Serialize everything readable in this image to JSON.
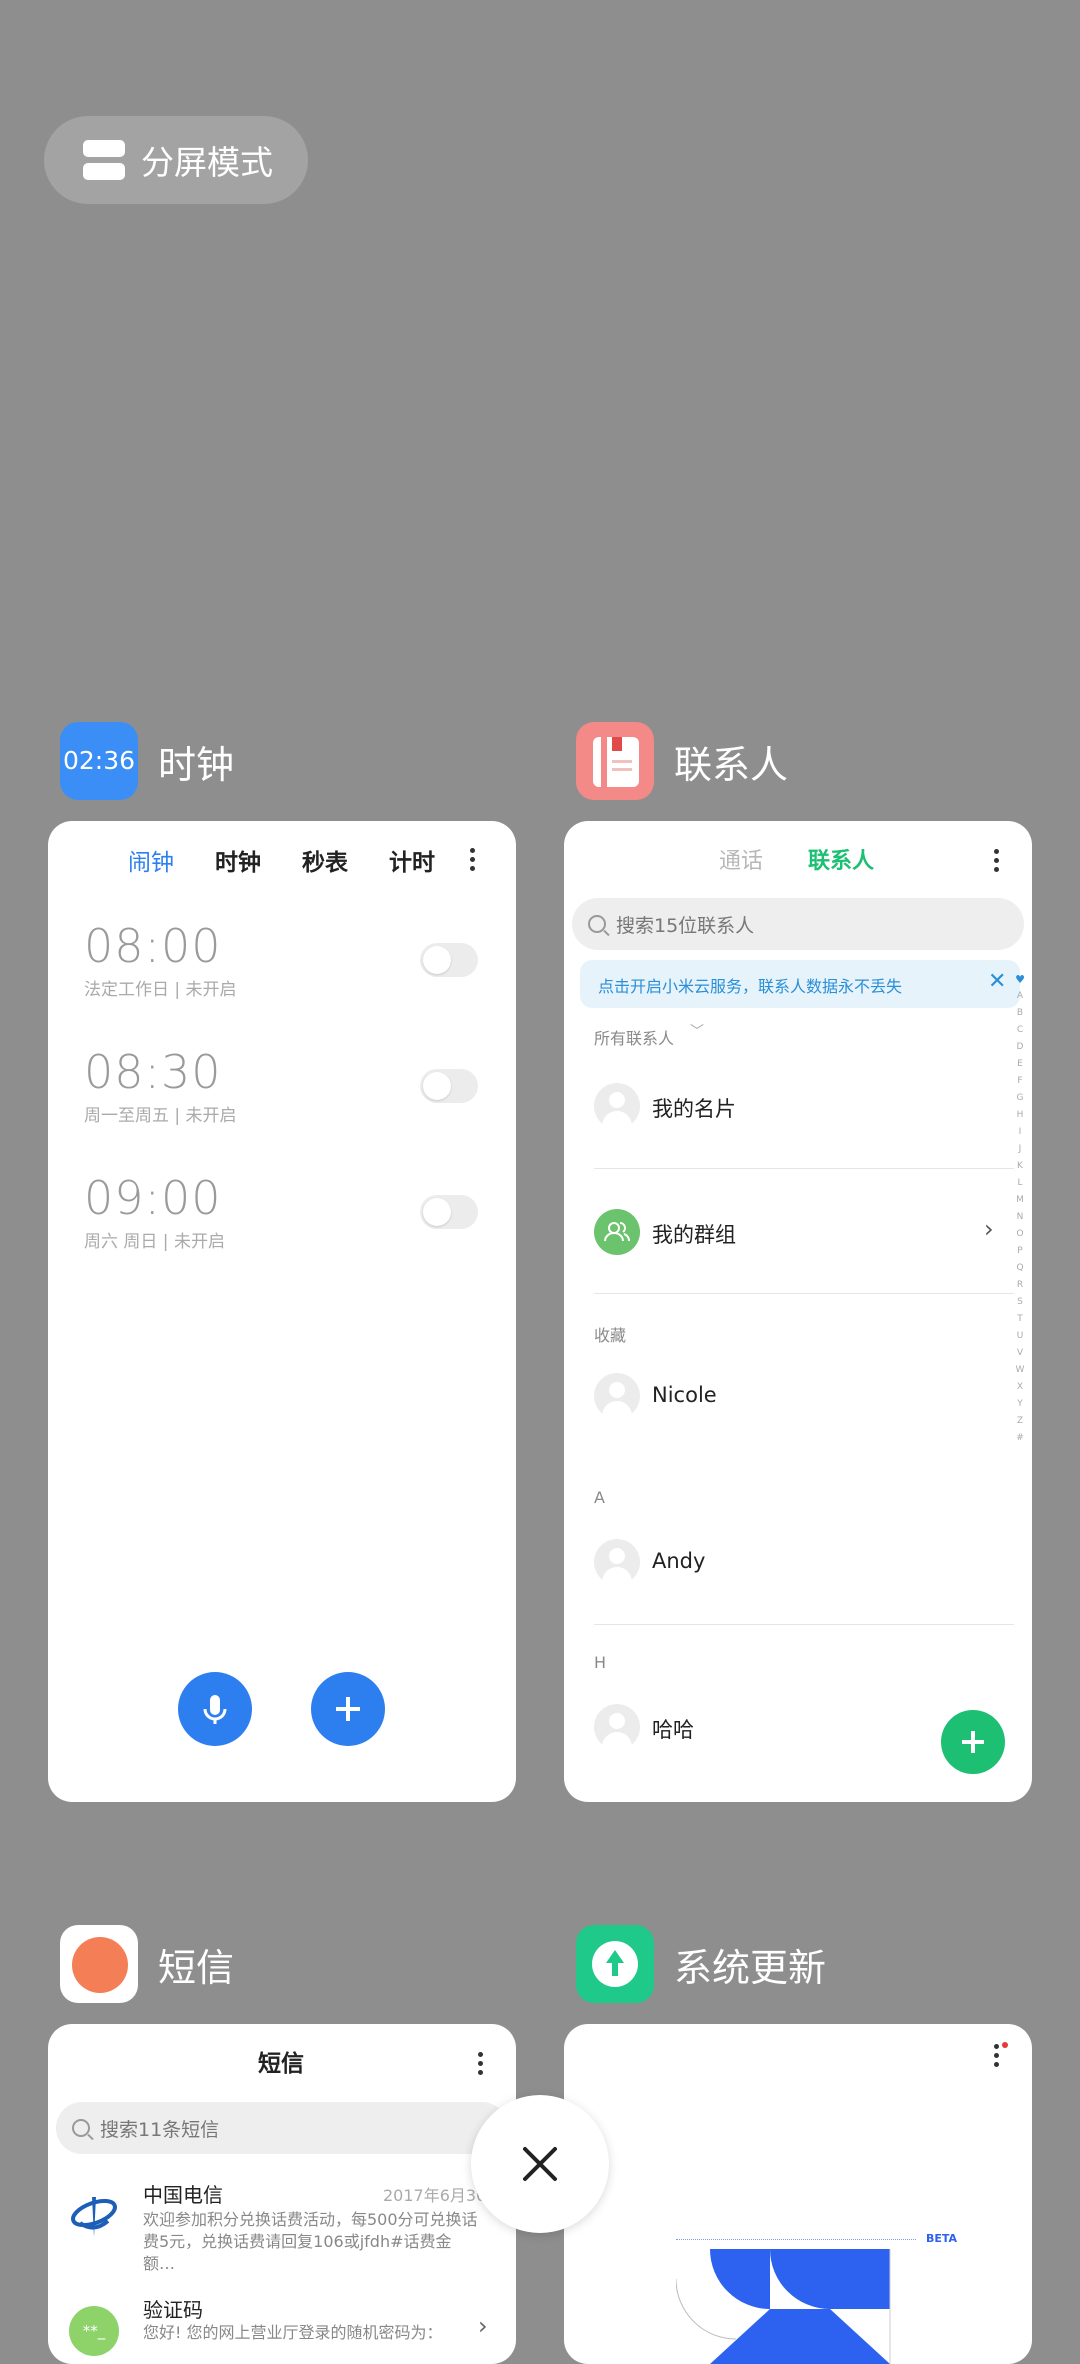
{
  "split": {
    "label": "分屏模式"
  },
  "apps": {
    "clock": {
      "name": "时钟",
      "icon_time": "02:36"
    },
    "contacts": {
      "name": "联系人"
    },
    "messages": {
      "name": "短信"
    },
    "update": {
      "name": "系统更新"
    }
  },
  "clock": {
    "tabs": [
      "闹钟",
      "时钟",
      "秒表",
      "计时"
    ],
    "alarms": [
      {
        "time": "08:00",
        "sub": "法定工作日 | 未开启"
      },
      {
        "time": "08:30",
        "sub": "周一至周五 | 未开启"
      },
      {
        "time": "09:00",
        "sub": "周六 周日 | 未开启"
      }
    ]
  },
  "contacts": {
    "tabs": [
      "通话",
      "联系人"
    ],
    "search_placeholder": "搜索15位联系人",
    "banner": "点击开启小米云服务，联系人数据永不丢失",
    "filter": "所有联系人",
    "my_card": "我的名片",
    "my_group": "我的群组",
    "section_fav": "收藏",
    "section_a": "A",
    "section_h": "H",
    "entries": [
      "Nicole",
      "Andy",
      "哈哈"
    ],
    "index": [
      "♥",
      "A",
      "B",
      "C",
      "D",
      "E",
      "F",
      "G",
      "H",
      "I",
      "J",
      "K",
      "L",
      "M",
      "N",
      "O",
      "P",
      "Q",
      "R",
      "S",
      "T",
      "U",
      "V",
      "W",
      "X",
      "Y",
      "Z",
      "#"
    ]
  },
  "messages": {
    "title": "短信",
    "search_placeholder": "搜索11条短信",
    "items": [
      {
        "name": "中国电信",
        "date": "2017年6月30",
        "body1": "欢迎参加积分兑换话费活动，每500分可兑换话",
        "body2": "费5元，兑换话费请回复106或jfdh#话费金额…"
      },
      {
        "name": "验证码",
        "body1": "您好! 您的网上营业厅登录的随机密码为：",
        "avatar_text": "**_"
      }
    ]
  },
  "update": {
    "badge": "BETA"
  },
  "colors": {
    "accent": "#2d7ff0",
    "contacts_green": "#1dbf73",
    "background": "#8e8e8e"
  }
}
